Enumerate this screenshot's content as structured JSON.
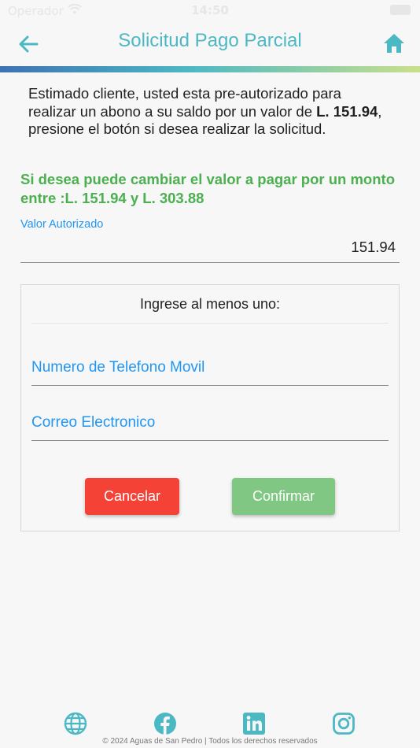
{
  "status_bar": {
    "carrier": "Operador",
    "time": "14:50"
  },
  "header": {
    "title": "Solicitud Pago Parcial",
    "back_icon": "arrow-left-icon",
    "home_icon": "home-icon"
  },
  "intro": {
    "text_before": "Estimado cliente, usted esta pre-autorizado para realizar un abono a su saldo por un valor de ",
    "amount": "L. 151.94",
    "text_after": ", presione el botón si desea realizar la solicitud."
  },
  "range_message": "Si desea puede cambiar el valor a pagar por un monto entre :L. 151.94 y L. 303.88",
  "valor": {
    "label": "Valor Autorizado",
    "value": "151.94"
  },
  "contact_card": {
    "heading": "Ingrese al menos uno:",
    "phone_placeholder": "Numero de Telefono Movil",
    "email_placeholder": "Correo Electronico",
    "cancel_label": "Cancelar",
    "confirm_label": "Confirmar"
  },
  "footer": {
    "icons": [
      "globe-icon",
      "facebook-icon",
      "linkedin-icon",
      "instagram-icon"
    ],
    "copyright": "© 2024 Aguas de San Pedro | Todos los derechos reservados"
  },
  "colors": {
    "accent": "#4cb8c4",
    "link_blue": "#2196f3",
    "success_green": "#4caf50",
    "cancel_red": "#f44336",
    "confirm_green": "#81c784"
  }
}
